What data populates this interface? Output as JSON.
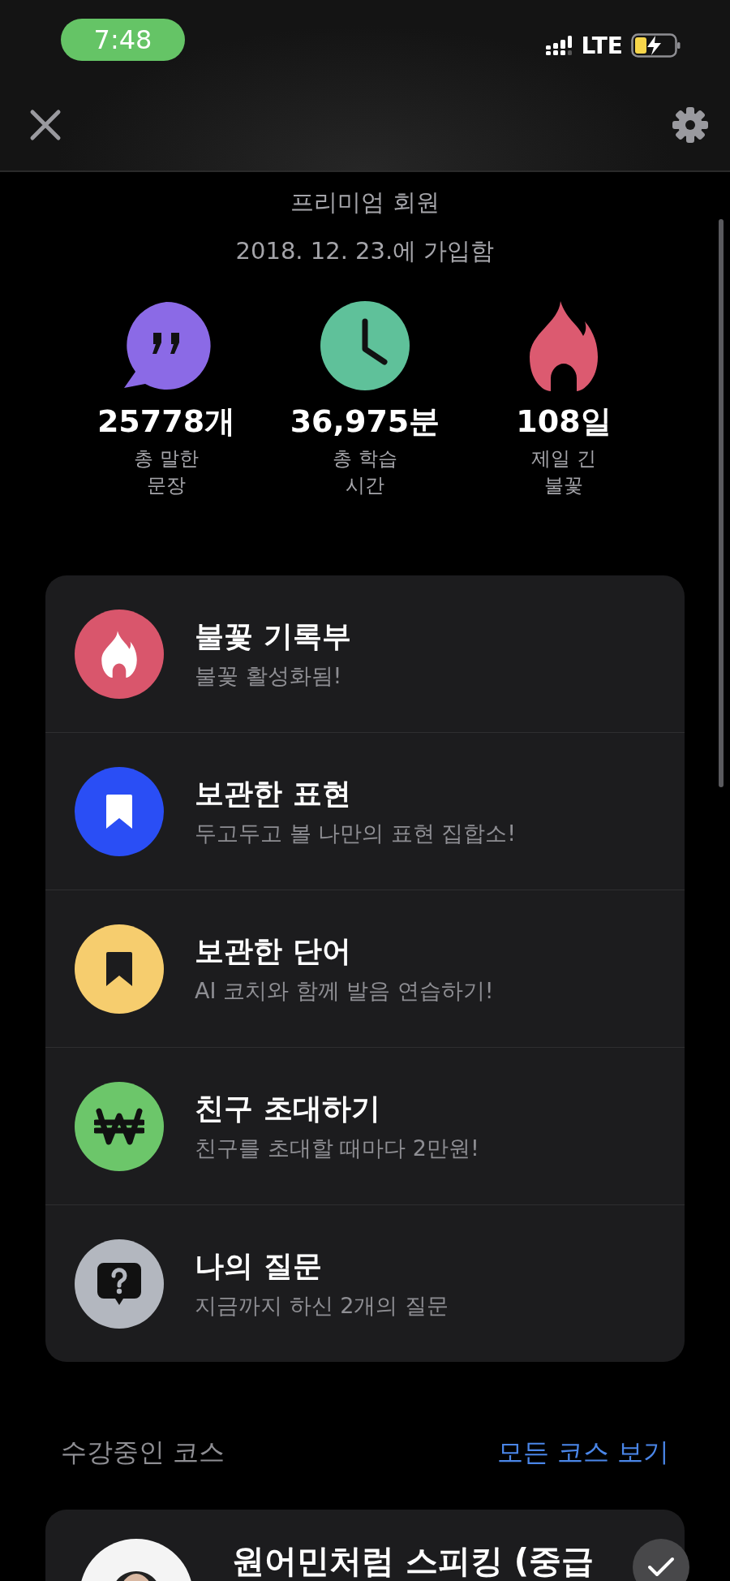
{
  "status_bar": {
    "time": "7:48",
    "network": "LTE"
  },
  "profile": {
    "membership": "프리미엄 회원",
    "joined": "2018. 12. 23.에 가입함"
  },
  "stats": [
    {
      "kind": "quote",
      "color": "#8b6ae6",
      "value": "25778개",
      "label_lines": [
        "총 말한",
        "문장"
      ]
    },
    {
      "kind": "clock",
      "color": "#5fc19a",
      "value": "36,975분",
      "label_lines": [
        "총 학습",
        "시간"
      ]
    },
    {
      "kind": "flame",
      "color": "#dc5a70",
      "value": "108일",
      "label_lines": [
        "제일 긴",
        "불꽃"
      ]
    }
  ],
  "menu": [
    {
      "kind": "flame",
      "color": "#d9566c",
      "title": "불꽃 기록부",
      "subtitle": "불꽃 활성화됨!"
    },
    {
      "kind": "bookmark",
      "color": "#2a4ef5",
      "title": "보관한 표현",
      "subtitle": "두고두고 볼 나만의 표현 집합소!"
    },
    {
      "kind": "bookmark-dark",
      "color": "#f6cd6e",
      "title": "보관한 단어",
      "subtitle": "AI 코치와 함께 발음 연습하기!"
    },
    {
      "kind": "won",
      "color": "#6cc66a",
      "title": "친구 초대하기",
      "subtitle": "친구를 초대할 때마다 2만원!"
    },
    {
      "kind": "question",
      "color": "#b3b7bf",
      "title": "나의 질문",
      "subtitle": "지금까지 하신 2개의 질문"
    }
  ],
  "courses": {
    "heading": "수강중인 코스",
    "link": "모든 코스 보기",
    "items": [
      {
        "title": "원어민처럼 스피킹 (중급",
        "checked": true
      }
    ]
  }
}
